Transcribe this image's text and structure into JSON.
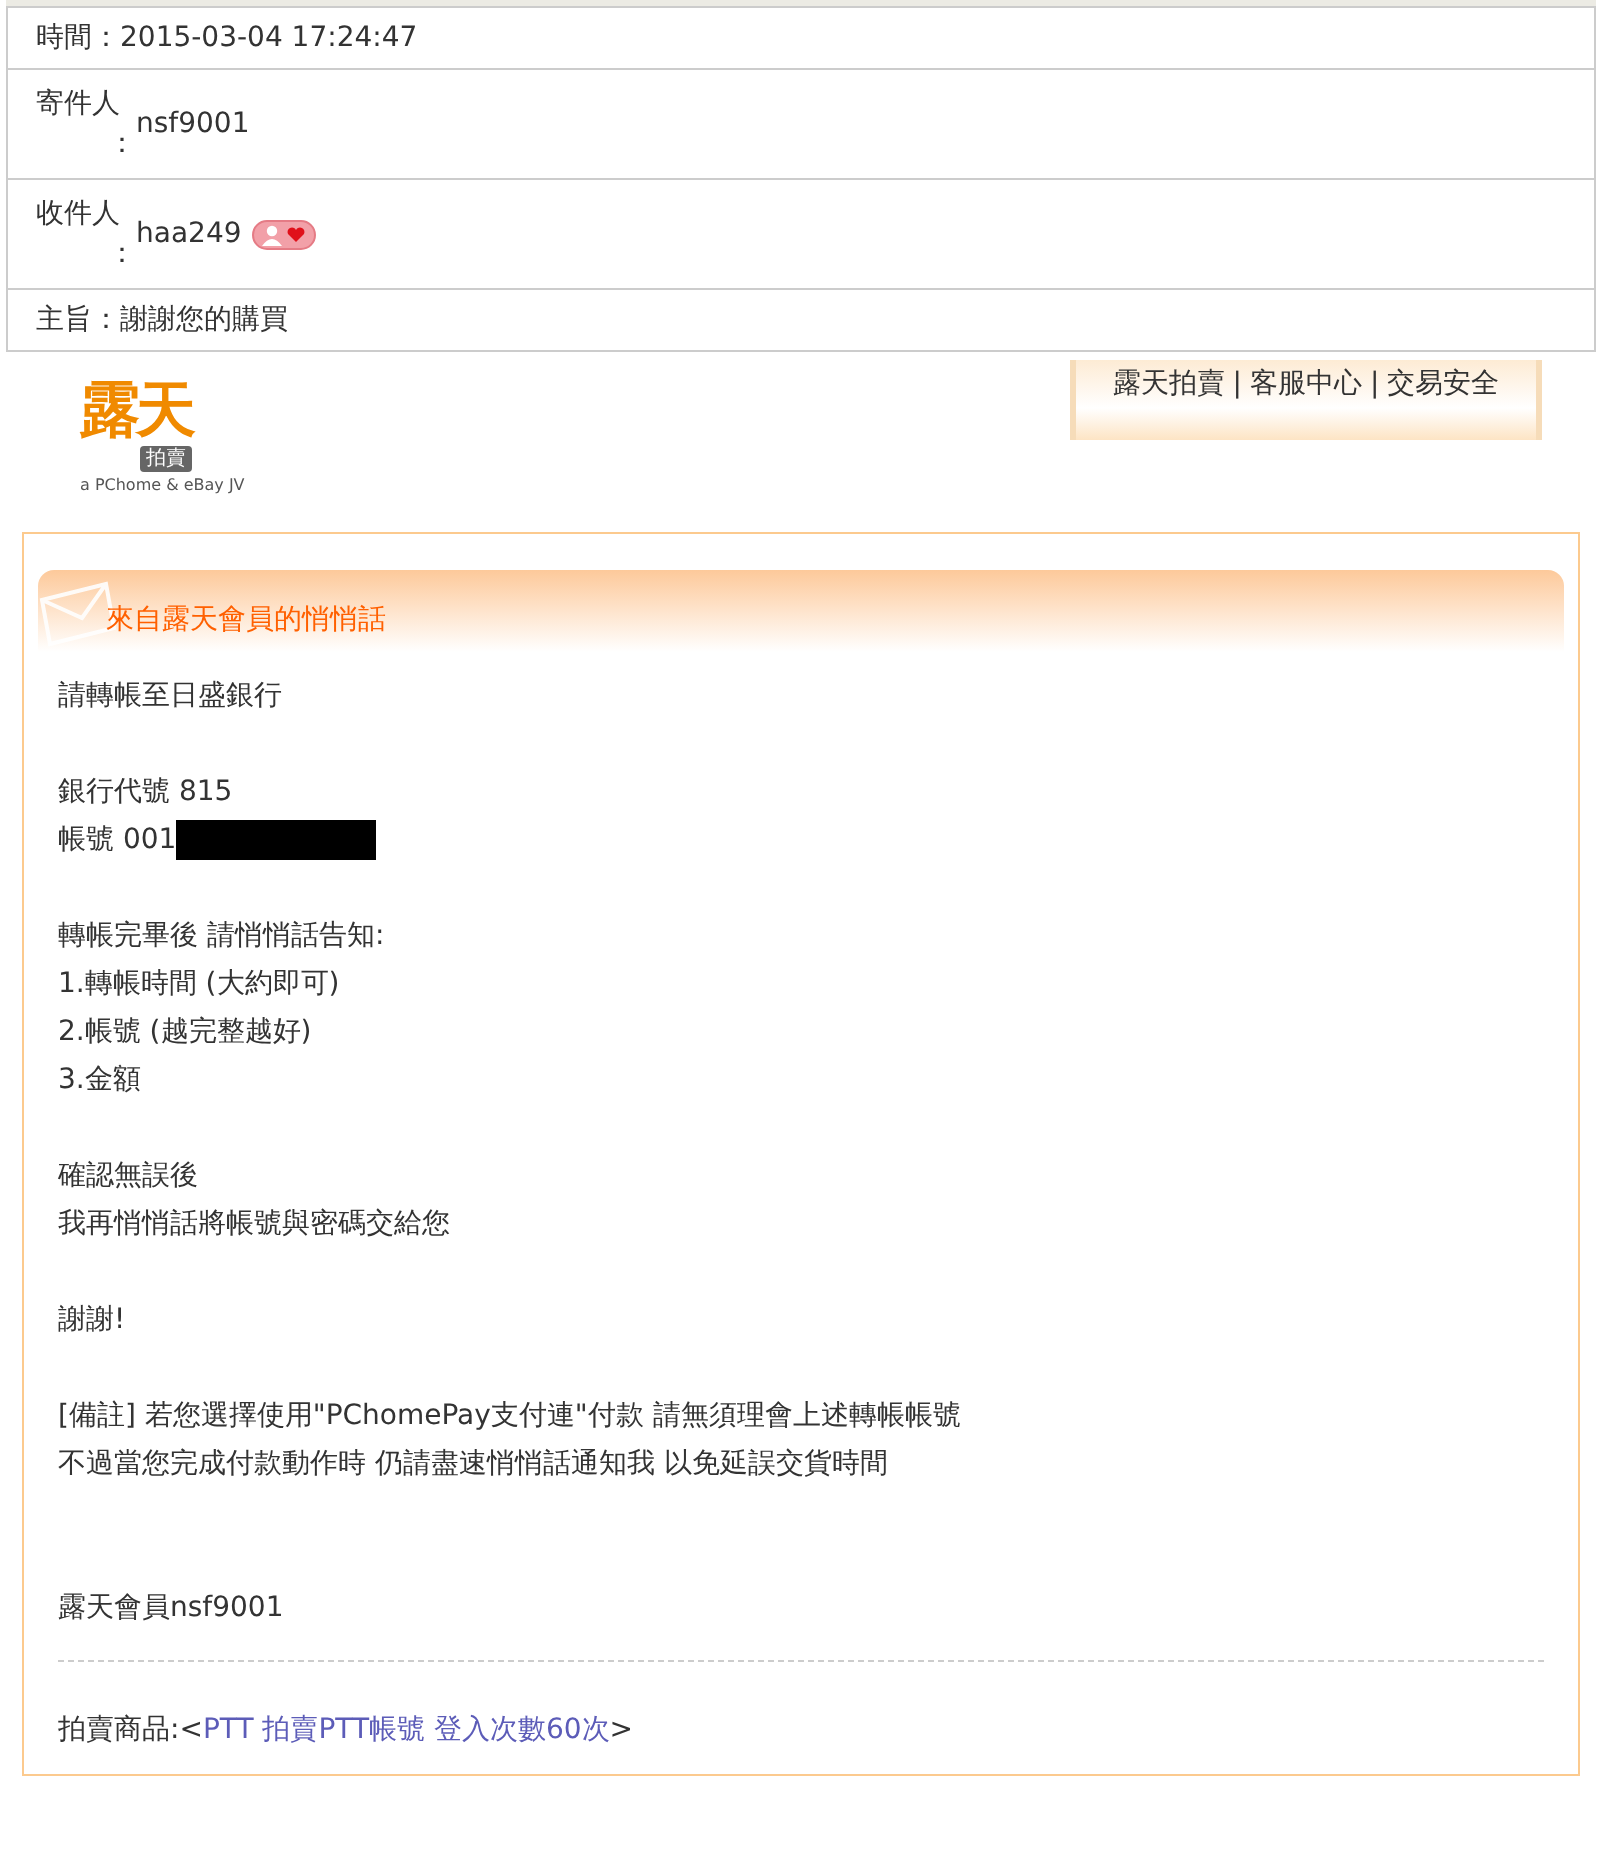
{
  "mail_header": [
    {
      "label": "時間：",
      "value": "2015-03-04 17:24:47"
    },
    {
      "label": "寄件人：",
      "value": "nsf9001"
    },
    {
      "label": "收件人：",
      "value": "haa249",
      "badge": true
    },
    {
      "label": "主旨：",
      "value": "謝謝您的購買"
    }
  ],
  "site_logo": {
    "name": "露天",
    "tag": "拍賣",
    "tagline": "a PChome & eBay JV"
  },
  "nav": {
    "links": [
      "露天拍賣",
      "客服中心",
      "交易安全"
    ],
    "separator": "|"
  },
  "message": {
    "title": "來自露天會員的悄悄話",
    "paragraphs": [
      [
        {
          "text": "請轉帳至日盛銀行"
        }
      ],
      [
        {
          "text": "銀行代號 815"
        },
        {
          "text": "帳號 001",
          "redacted": true
        }
      ],
      [
        {
          "text": "轉帳完畢後 請悄悄話告知:"
        },
        {
          "text": "1.轉帳時間 (大約即可)"
        },
        {
          "text": "2.帳號 (越完整越好)"
        },
        {
          "text": "3.金額"
        }
      ],
      [
        {
          "text": "確認無誤後"
        },
        {
          "text": "我再悄悄話將帳號與密碼交給您"
        }
      ],
      [
        {
          "text": "謝謝!"
        }
      ],
      [
        {
          "text": "[備註] 若您選擇使用\"PChomePay支付連\"付款 請無須理會上述轉帳帳號"
        },
        {
          "text": "不過當您完成付款動作時 仍請盡速悄悄話通知我 以免延誤交貨時間"
        }
      ]
    ],
    "signature": "露天會員nsf9001",
    "item": {
      "prefix": "拍賣商品:<",
      "link": "PTT 拍賣PTT帳號 登入次數60次",
      "suffix": ">"
    }
  }
}
